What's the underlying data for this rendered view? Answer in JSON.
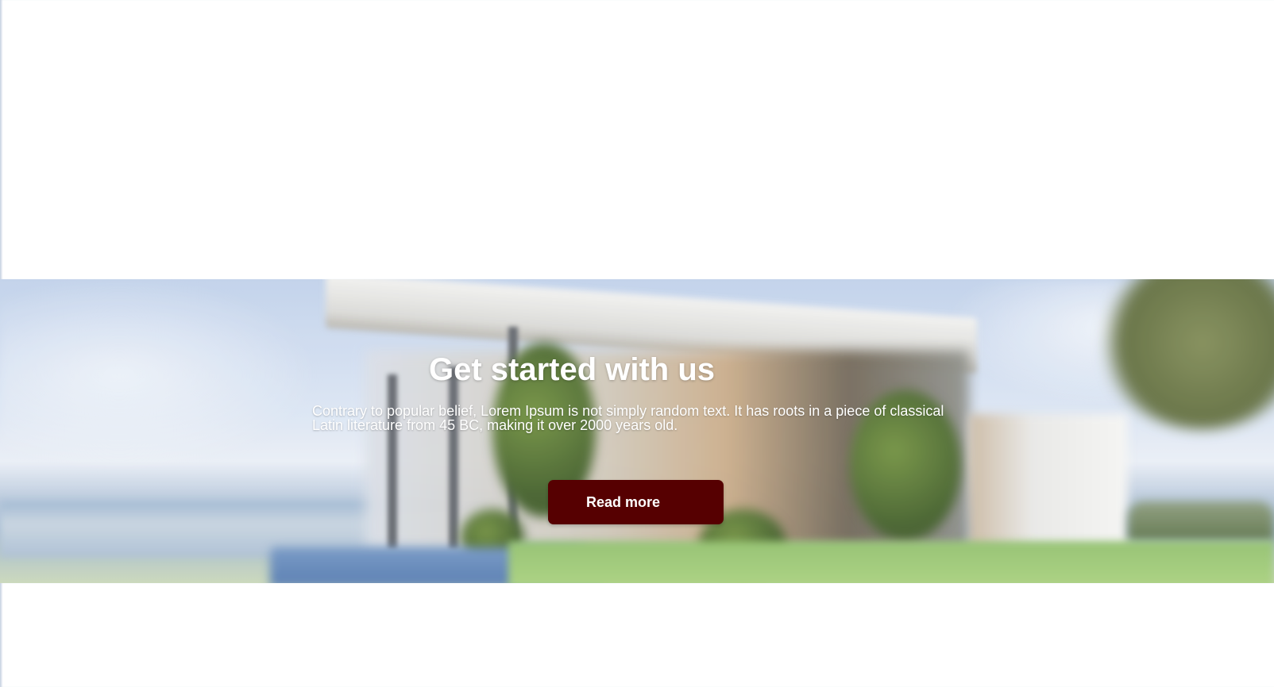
{
  "hero": {
    "title": "Get started with us",
    "description": "Contrary to popular belief, Lorem Ipsum is not simply random text. It has roots in a piece of classical Latin literature from 45 BC, making it over 2000 years old.",
    "cta_label": "Read more",
    "background_image": "blurred-modern-beach-house-photo"
  },
  "colors": {
    "page_background": "#ffffff",
    "button_background": "#560001",
    "button_text": "#ffffff",
    "hero_text": "#ffffff"
  }
}
